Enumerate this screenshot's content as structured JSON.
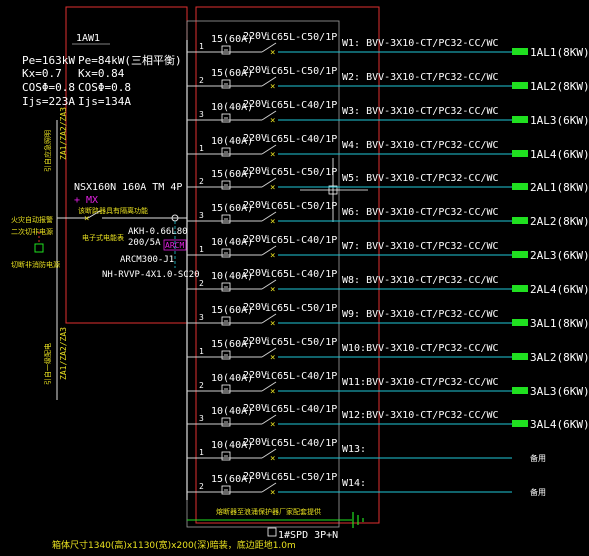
{
  "panel": {
    "name": "1AW1",
    "incoming": {
      "pe": "Pe=163kW",
      "kx": "Kx=0.7",
      "cos": "COSΦ=0.8",
      "ijs": "Ijs=223A"
    },
    "local": {
      "pe": "Pe=84kW(三相平衡)",
      "kx": "Kx=0.84",
      "cos": "COSΦ=0.8",
      "ijs": "Ijs=134A"
    },
    "main_breaker": "NSX160N 160A TM 4P",
    "mx": "+ MX",
    "breaker_note": "该断路器具有隔离功能",
    "fire_note_1": "火灾自动报警",
    "fire_note_2": "二次切非电源",
    "fire_note_3": "切断非消防电源",
    "meter_note": "电子式电能表",
    "ct": "AKH-0.66L80",
    "ct_ratio": "200/5A",
    "arcm_tag": "ARCM",
    "meter": "ARCM300-J1",
    "incoming_cable": "NH-RVVP-4X1.0-SC20",
    "vertical_upper": "引自应急照明",
    "vertical_upper_2": "ZA1/ZA2/ZA3",
    "vertical_lower": "引自一级配电",
    "vertical_lower_2": "ZA1/ZA2/ZA3",
    "spd": "1#SPD 3P+N",
    "spd_note": "熔断器至浪涌保护器厂家配套提供",
    "dimensions": "箱体尺寸1340(高)x1130(宽)x200(深)暗装，底边距地1.0m"
  },
  "circuits": [
    {
      "phase": "1",
      "fuse": "15(60A)",
      "volt": "220V",
      "breaker": "iC65L-C50/1P",
      "cable": "W1: BVV-3X10-CT/PC32-CC/WC",
      "target": "1AL1(8KW)"
    },
    {
      "phase": "2",
      "fuse": "15(60A)",
      "volt": "220V",
      "breaker": "iC65L-C50/1P",
      "cable": "W2: BVV-3X10-CT/PC32-CC/WC",
      "target": "1AL2(8KW)"
    },
    {
      "phase": "3",
      "fuse": "10(40A)",
      "volt": "220V",
      "breaker": "iC65L-C40/1P",
      "cable": "W3: BVV-3X10-CT/PC32-CC/WC",
      "target": "1AL3(6KW)"
    },
    {
      "phase": "1",
      "fuse": "10(40A)",
      "volt": "220V",
      "breaker": "iC65L-C40/1P",
      "cable": "W4: BVV-3X10-CT/PC32-CC/WC",
      "target": "1AL4(6KW)"
    },
    {
      "phase": "2",
      "fuse": "15(60A)",
      "volt": "220V",
      "breaker": "iC65L-C50/1P",
      "cable": "W5: BVV-3X10-CT/PC32-CC/WC",
      "target": "2AL1(8KW)"
    },
    {
      "phase": "3",
      "fuse": "15(60A)",
      "volt": "220V",
      "breaker": "iC65L-C50/1P",
      "cable": "W6: BVV-3X10-CT/PC32-CC/WC",
      "target": "2AL2(8KW)"
    },
    {
      "phase": "1",
      "fuse": "10(40A)",
      "volt": "220V",
      "breaker": "iC65L-C40/1P",
      "cable": "W7: BVV-3X10-CT/PC32-CC/WC",
      "target": "2AL3(6KW)"
    },
    {
      "phase": "2",
      "fuse": "10(40A)",
      "volt": "220V",
      "breaker": "iC65L-C40/1P",
      "cable": "W8: BVV-3X10-CT/PC32-CC/WC",
      "target": "2AL4(6KW)"
    },
    {
      "phase": "3",
      "fuse": "15(60A)",
      "volt": "220V",
      "breaker": "iC65L-C50/1P",
      "cable": "W9: BVV-3X10-CT/PC32-CC/WC",
      "target": "3AL1(8KW)"
    },
    {
      "phase": "1",
      "fuse": "15(60A)",
      "volt": "220V",
      "breaker": "iC65L-C50/1P",
      "cable": "W10:BVV-3X10-CT/PC32-CC/WC",
      "target": "3AL2(8KW)"
    },
    {
      "phase": "2",
      "fuse": "10(40A)",
      "volt": "220V",
      "breaker": "iC65L-C40/1P",
      "cable": "W11:BVV-3X10-CT/PC32-CC/WC",
      "target": "3AL3(6KW)"
    },
    {
      "phase": "3",
      "fuse": "10(40A)",
      "volt": "220V",
      "breaker": "iC65L-C40/1P",
      "cable": "W12:BVV-3X10-CT/PC32-CC/WC",
      "target": "3AL4(6KW)"
    },
    {
      "phase": "1",
      "fuse": "10(40A)",
      "volt": "220V",
      "breaker": "iC65L-C40/1P",
      "cable": "W13:",
      "target": "备用"
    },
    {
      "phase": "2",
      "fuse": "15(60A)",
      "volt": "220V",
      "breaker": "iC65L-C50/1P",
      "cable": "W14:",
      "target": "备用"
    }
  ],
  "colors": {
    "frame": "#e03030",
    "bus": "#d0d0d0",
    "cyan": "#20c8d8",
    "yellow": "#e8e020",
    "green": "#20e020",
    "magenta": "#e020e0",
    "text": "#ffffff"
  }
}
